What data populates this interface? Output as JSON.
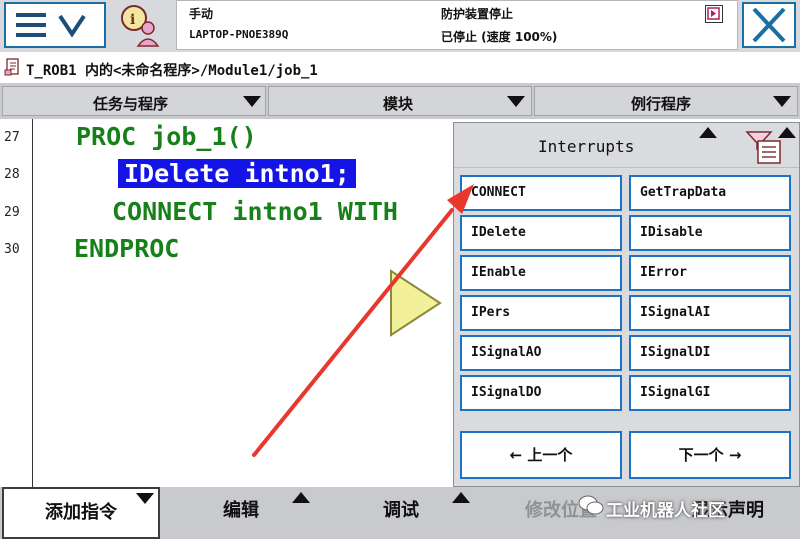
{
  "status": {
    "mode": "手动",
    "controller": "LAPTOP-PNOE389Q",
    "safety": "防护装置停止",
    "state": "已停止 (速度 100%)"
  },
  "path": "T_ROB1 内的<未命名程序>/Module1/job_1",
  "tabs": [
    {
      "label": "任务与程序"
    },
    {
      "label": "模块"
    },
    {
      "label": "例行程序"
    }
  ],
  "editor": {
    "line_numbers": [
      "27",
      "28",
      "29",
      "30"
    ],
    "lines": [
      "PROC job_1()",
      "IDelete intno1;",
      "CONNECT intno1 WITH",
      "ENDPROC"
    ],
    "selected_line": 1
  },
  "panel": {
    "title": "Interrupts",
    "items": [
      "CONNECT",
      "GetTrapData",
      "IDelete",
      "IDisable",
      "IEnable",
      "IError",
      "IPers",
      "ISignalAI",
      "ISignalAO",
      "ISignalDI",
      "ISignalDO",
      "ISignalGI"
    ],
    "prev_label": "←   上一个",
    "next_label": "下一个  →"
  },
  "bottom": {
    "add_instruction": "添加指令",
    "edit": "编辑",
    "debug": "调试",
    "modify_position": "修改位置",
    "hide_decl": "显示声明"
  },
  "watermark": "工业机器人社区",
  "colors": {
    "code_green": "#18801a",
    "selection_blue": "#1414e6",
    "button_border": "#1f73c4",
    "arrow_red": "#e8372c",
    "play_yellow": "#f2f09a"
  }
}
